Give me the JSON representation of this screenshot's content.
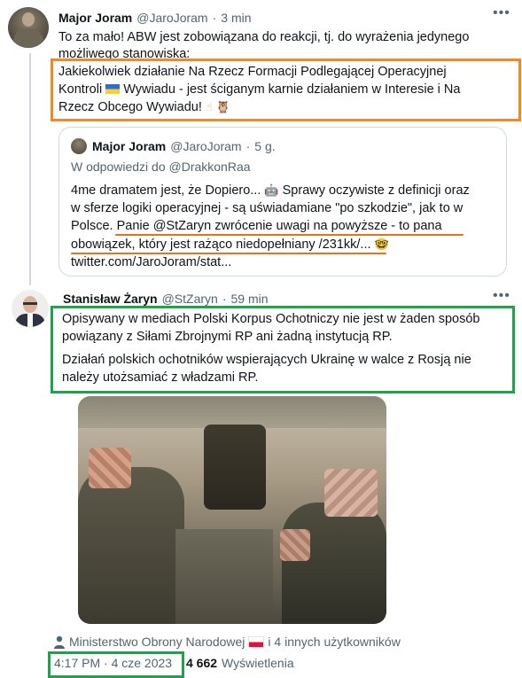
{
  "tweet1": {
    "author_name": "Major Joram",
    "author_handle": "@JaroJoram",
    "dot": "·",
    "time": "3 min",
    "more_icon": "more-dots-icon",
    "text_intro_line1": "To za mało! ABW jest zobowiązana do reakcji, tj. do wyrażenia jedynego",
    "text_intro_line2": "możliwego stanowiska:",
    "text_hl_line1": "Jakiekolwiek działanie Na Rzecz Formacji Podlegającej Operacyjnej",
    "text_hl_line2a": "Kontroli",
    "text_hl_line2b": "Wywiadu - jest ściganym karnie działaniem w Interesie i Na",
    "text_hl_line3": "Rzecz Obcego Wywiadu!",
    "emoji_finger": "☝",
    "emoji_owl": "🦉",
    "highlight_color": "#f08a24"
  },
  "quote": {
    "author_name": "Major Joram",
    "author_handle": "@JaroJoram",
    "dot": "·",
    "time": "5 g.",
    "reply_to": "W odpowiedzi do @DrakkonRaa",
    "line1a": "4me dramatem jest, że Dopiero...",
    "line1b": "Sprawy oczywiste z definicji oraz",
    "line2": "w sferze logiki operacyjnej - są uświadamiane \"po szkodzie\", jak to w",
    "line3a": "Polsce.",
    "line3b": "Panie @StZaryn zwrócenie uwagi na powyższe - to pana",
    "line4": "obowiązek, który jest rażąco niedopełniany /231kk/...",
    "line5": "twitter.com/JaroJoram/stat...",
    "emoji_robot": "🤖",
    "emoji_nerd": "🤓",
    "underline_color": "#e6711e"
  },
  "tweet2": {
    "author_name": "Stanisław Żaryn",
    "author_handle": "@StZaryn",
    "dot": "·",
    "time": "59 min",
    "more_icon": "more-dots-icon",
    "p1_line1": "Opisywany w mediach Polski Korpus Ochotniczy nie jest w żaden sposób",
    "p1_line2": "powiązany z Siłami Zbrojnymi RP ani żadną instytucją RP.",
    "p2_line1": "Działań polskich ochotników wspierających Ukrainę w walce z Rosją nie",
    "p2_line2": "należy utożsamiać z władzami RP.",
    "highlight_color": "#1fa34a",
    "tagged_users_a": "Ministerstwo Obrony Narodowej",
    "tagged_users_b": "i 4 innych użytkowników",
    "timestamp": "4:17 PM · 4 cze 2023",
    "views_count": "4 662",
    "views_label": "Wyświetlenia"
  }
}
